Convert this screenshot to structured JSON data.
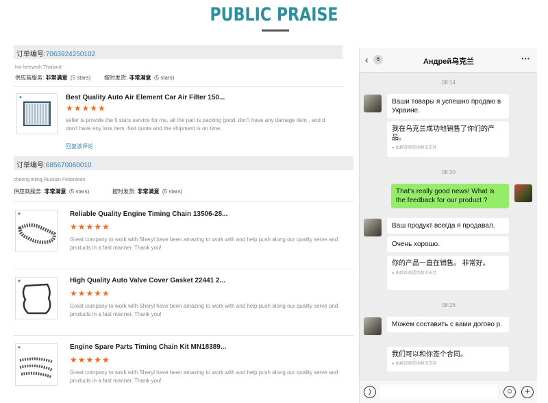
{
  "header": {
    "title": "PUBLIC PRAISE"
  },
  "orders": [
    {
      "order_label": "订单编号:",
      "order_number": "7063924250102",
      "buyer": "hor beeyeoh,Thailand",
      "supplier_service_label": "供应商服务:",
      "supplier_service_value": "非常满意",
      "supplier_stars": "(5 stars)",
      "shipping_label": "按时发货:",
      "shipping_value": "非常满意",
      "shipping_stars": "(5 stars)",
      "products": [
        {
          "name": "Best Quality Auto Air Element Car Air Filter 150...",
          "stars": "★★★★★",
          "review": "seller is provide the 5 stars service for me, all the part is packing good, don't have any damage item , and d don't have any loss item, fast quote and the shipment is on time.",
          "reply": "回复该评论"
        }
      ]
    },
    {
      "order_label": "订单编号:",
      "order_number": "685670060010",
      "buyer": "cheong miing,Russian Federation",
      "supplier_service_label": "供应商服务:",
      "supplier_service_value": "非常满意",
      "supplier_stars": "(5 stars)",
      "shipping_label": "按时发货:",
      "shipping_value": "非常满意",
      "shipping_stars": "(5 stars)",
      "products": [
        {
          "name": "Reliable Quality Engine Timing Chain 13506-28...",
          "stars": "★★★★★",
          "review": "Great company to work with Sheryl have been amazing to work with and help push along our quality serve and products in a fast manner. Thank you!"
        },
        {
          "name": "High Quality Auto Valve Cover Gasket 22441 2...",
          "stars": "★★★★★",
          "review": "Great company to work with Sheryl have been amazing to work with and help push along our quality serve and products in a fast manner. Thank you!"
        },
        {
          "name": "Engine Spare Parts Timing Chain Kit MN18389...",
          "stars": "★★★★★",
          "review": "Great company to work with Sheryl have been amazing to work with and help push along our quality serve and products in a fast manner. Thank you!"
        }
      ]
    }
  ],
  "chat": {
    "back_count": "6",
    "contact_name": "Андрей乌克兰",
    "more": "···",
    "translation_note": "由翻译君提供翻译支持",
    "times": [
      "08:14",
      "08:20",
      "08:26"
    ],
    "messages": [
      {
        "text": "Ваши товары я успешно продаю в Украине."
      },
      {
        "text": "我在乌克兰成功地销售了你们的产品。"
      },
      {
        "text": "That's really good news! What is the feedback for our product ?"
      },
      {
        "text": "Ваш продукт всегда я продавал."
      },
      {
        "text": "Очень хорошо."
      },
      {
        "text": "你的产品一直在销售。 非常好。"
      },
      {
        "text": "Можем составить с вами догово р."
      },
      {
        "text": "我们可以和你签个合同。"
      }
    ]
  },
  "colors": {
    "accent": "#2c8f9e",
    "stars": "#f36a22",
    "link": "#2a7fc7",
    "chat_green": "#95ec69"
  }
}
